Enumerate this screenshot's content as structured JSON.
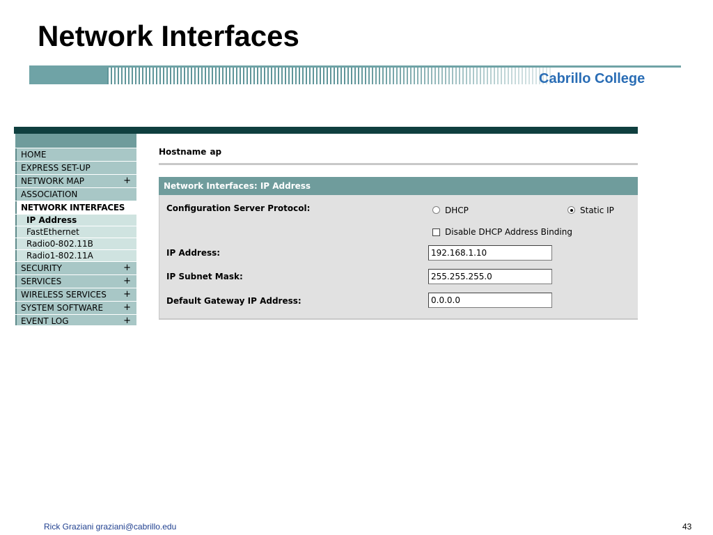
{
  "slide": {
    "title": "Network Interfaces",
    "brand": "Cabrillo College",
    "footer_author": "Rick Graziani  graziani@cabrillo.edu",
    "page_number": "43"
  },
  "colors": {
    "teal_header": "#6f9c9c",
    "nav_item_bg": "#a8c7c6",
    "nav_sub_bg": "#cfe3e0",
    "top_bar": "#0f3f3f",
    "brand_text": "#2a6db5",
    "panel_bg": "#e1e1e1"
  },
  "nav": {
    "items": [
      {
        "label": "HOME",
        "expandable": false
      },
      {
        "label": "EXPRESS SET-UP",
        "expandable": false
      },
      {
        "label": "NETWORK MAP",
        "expandable": true
      },
      {
        "label": "ASSOCIATION",
        "expandable": false
      },
      {
        "label": "NETWORK INTERFACES",
        "expandable": false,
        "active": true
      },
      {
        "label": "SECURITY",
        "expandable": true
      },
      {
        "label": "SERVICES",
        "expandable": true
      },
      {
        "label": "WIRELESS SERVICES",
        "expandable": true
      },
      {
        "label": "SYSTEM SOFTWARE",
        "expandable": true
      },
      {
        "label": "EVENT LOG",
        "expandable": true
      }
    ],
    "expand_glyph": "+",
    "subitems": [
      {
        "label": "IP Address",
        "current": true
      },
      {
        "label": "FastEthernet",
        "current": false
      },
      {
        "label": "Radio0-802.11B",
        "current": false
      },
      {
        "label": "Radio1-802.11A",
        "current": false
      }
    ]
  },
  "header": {
    "hostname_label": "Hostname",
    "hostname_value": "ap"
  },
  "panel": {
    "title": "Network Interfaces: IP Address",
    "config_protocol_label": "Configuration Server Protocol:",
    "protocol_options": [
      {
        "label": "DHCP",
        "selected": false
      },
      {
        "label": "Static IP",
        "selected": true
      }
    ],
    "disable_binding_label": "Disable DHCP Address Binding",
    "disable_binding_checked": false,
    "fields": [
      {
        "label": "IP Address:",
        "value": "192.168.1.10"
      },
      {
        "label": "IP Subnet Mask:",
        "value": "255.255.255.0"
      },
      {
        "label": "Default Gateway IP Address:",
        "value": "0.0.0.0"
      }
    ]
  }
}
